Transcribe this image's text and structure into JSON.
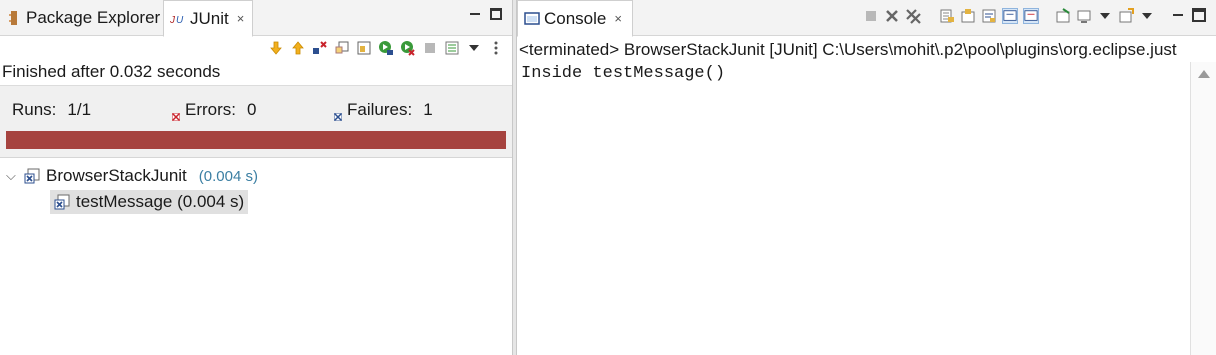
{
  "left_tabs": [
    {
      "label": "Package Explorer",
      "icon": "package-icon",
      "active": false
    },
    {
      "label": "JUnit",
      "icon": "junit-icon",
      "active": true,
      "close": "×"
    }
  ],
  "junit": {
    "status": "Finished after 0.032 seconds",
    "runs_label": "Runs:",
    "runs_value": "1/1",
    "errors_label": "Errors:",
    "errors_value": "0",
    "failures_label": "Failures:",
    "failures_value": "1",
    "progress_color": "#a6433f",
    "progress_fraction": 1.0,
    "tree": {
      "suite_name": "BrowserStackJunit",
      "suite_time": "(0.004 s)",
      "test_name": "testMessage (0.004 s)"
    }
  },
  "console": {
    "tab_label": "Console",
    "tab_close": "×",
    "header": "<terminated> BrowserStackJunit [JUnit] C:\\Users\\mohit\\.p2\\pool\\plugins\\org.eclipse.just",
    "output": "Inside testMessage()"
  },
  "colors": {
    "failure_bar": "#a6433f",
    "time_text": "#3b7fa3",
    "selection": "#e0e0e0"
  }
}
